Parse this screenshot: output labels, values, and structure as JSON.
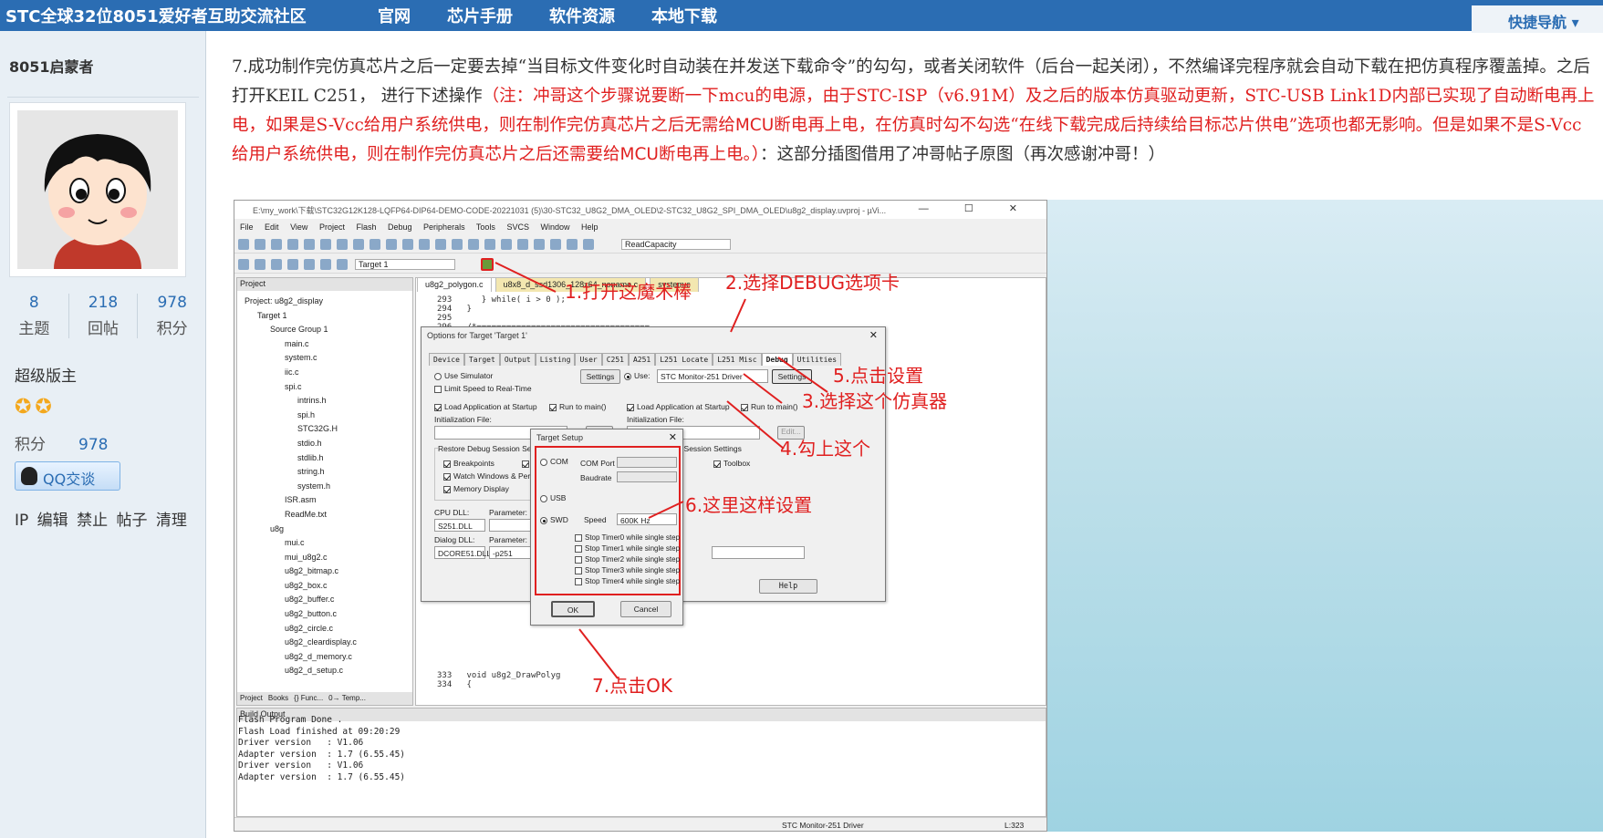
{
  "topbar": {
    "site_title": "STC全球32位8051爱好者互助交流社区",
    "nav": [
      "官网",
      "芯片手册",
      "软件资源",
      "本地下载"
    ],
    "quick_nav": "快捷导航"
  },
  "sidebar": {
    "username": "8051启蒙者",
    "stats": [
      {
        "value": "8",
        "label": "主题"
      },
      {
        "value": "218",
        "label": "回帖"
      },
      {
        "value": "978",
        "label": "积分"
      }
    ],
    "role": "超级版主",
    "score_label": "积分",
    "score_value": "978",
    "qq_button": "QQ交谈",
    "ops": "IP 编辑 禁止 帖子 清理"
  },
  "post": {
    "p1": "7.成功制作完仿真芯片之后一定要去掉“当目标文件变化时自动装在并发送下载命令”的勾勾，或者关闭软件（后台一起关闭），不然编译完程序就会自动下载在把仿真程序覆盖掉。之后打开KEIL C251， 进行下述操作",
    "p2_red1": "（注：冲哥这个步骤说要断一下mcu的电源，由于STC-ISP（v6.91M）及之后的版本仿真驱动更新，STC-USB Link1D内部已实现了自动断电再上电，如果是S-Vcc给用户系统供电，则在制作完仿真芯片之后",
    "p2_red_bold1": "无需给MCU",
    "p2_red2": "断电再上电，在仿真时勾不勾选“在线下载完成后持续给目标芯片供电”选项也都无影响。但是如果不是S-Vcc给用户系统供电，则在制作完仿真芯片之后",
    "p2_red_bold2": "还需要给MCU",
    "p2_red3": "断电再上电。）",
    "p3": "：这部分插图借用了冲哥帖子原图（再次感谢冲哥！）"
  },
  "screenshot": {
    "title": "E:\\my_work\\下载\\STC32G12K128-LQFP64-DIP64-DEMO-CODE-20221031 (5)\\30-STC32_U8G2_DMA_OLED\\2-STC32_U8G2_SPI_DMA_OLED\\u8g2_display.uvproj - µVi...",
    "menu": [
      "File",
      "Edit",
      "View",
      "Project",
      "Flash",
      "Debug",
      "Peripherals",
      "Tools",
      "SVCS",
      "Window",
      "Help"
    ],
    "toolbar_combo": "ReadCapacity",
    "target_combo": "Target 1",
    "project_header": "Project",
    "tree": [
      "Project: u8g2_display",
      "Target 1",
      "Source Group 1",
      "main.c",
      "system.c",
      "iic.c",
      "spi.c",
      "intrins.h",
      "spi.h",
      "STC32G.H",
      "stdio.h",
      "stdlib.h",
      "string.h",
      "system.h",
      "ISR.asm",
      "ReadMe.txt",
      "u8g",
      "mui.c",
      "mui_u8g2.c",
      "u8g2_bitmap.c",
      "u8g2_box.c",
      "u8g2_buffer.c",
      "u8g2_button.c",
      "u8g2_circle.c",
      "u8g2_cleardisplay.c",
      "u8g2_d_memory.c",
      "u8g2_d_setup.c"
    ],
    "bottom_tabs": [
      "Project",
      "Books",
      "{} Func...",
      "0→ Temp..."
    ],
    "editor_tabs": [
      "u8g2_polygon.c",
      "u8x8_d_ssd1306_128x64_noname.c",
      "system.c"
    ],
    "code_top": [
      "293      } while( i > 0 );",
      "294   }",
      "295",
      "296   /*==================================="
    ],
    "code_bottom": [
      "333   void u8g2_DrawPolyg",
      "334   {"
    ],
    "options": {
      "title": "Options for Target 'Target 1'",
      "tabs": [
        "Device",
        "Target",
        "Output",
        "Listing",
        "User",
        "C251",
        "A251",
        "L251 Locate",
        "L251 Misc",
        "Debug",
        "Utilities"
      ],
      "use_simulator": "Use Simulator",
      "limit_speed": "Limit Speed to Real-Time",
      "settings": "Settings",
      "use": "Use:",
      "driver": "STC Monitor-251 Driver",
      "load_app": "Load Application at Startup",
      "run_main": "Run to main()",
      "init_file": "Initialization File:",
      "edit": "Edit...",
      "restore": "Restore Debug Session Settings",
      "breakpoints": "Breakpoints",
      "toolbox": "Toolbox",
      "watch": "Watch Windows & Performance",
      "memory": "Memory Display",
      "cpu_dll": "CPU DLL:",
      "parameter": "Parameter:",
      "cpu_dll_val": "S251.DLL",
      "dialog_dll": "Dialog DLL:",
      "dialog_dll_val": "DCORE51.DLL",
      "dialog_param_val": "-p251",
      "help": "Help"
    },
    "target_setup": {
      "title": "Target Setup",
      "com": "COM",
      "com_port": "COM Port",
      "baudrate": "Baudrate",
      "usb": "USB",
      "swd": "SWD",
      "speed": "Speed",
      "speed_val": "600K Hz",
      "timers": [
        "Stop Timer0 while single step",
        "Stop Timer1 while single step",
        "Stop Timer2 while single step",
        "Stop Timer3 while single step",
        "Stop Timer4 while single step"
      ],
      "ok": "OK",
      "cancel": "Cancel"
    },
    "annotations": [
      "1.打开这魔术棒",
      "2.选择DEBUG选项卡",
      "5.点击设置",
      "3.选择这个仿真器",
      "4.勾上这个",
      "6.这里这样设置",
      "7.点击OK"
    ],
    "build_header": "Build Output",
    "build_lines": [
      "Flash Program Done .",
      "Flash Load finished at 09:20:29",
      "Driver version   : V1.06",
      "Adapter version  : 1.7 (6.55.45)",
      "Driver version   : V1.06",
      "Adapter version  : 1.7 (6.55.45)"
    ],
    "status_driver": "STC Monitor-251 Driver",
    "status_line": "L:323"
  }
}
